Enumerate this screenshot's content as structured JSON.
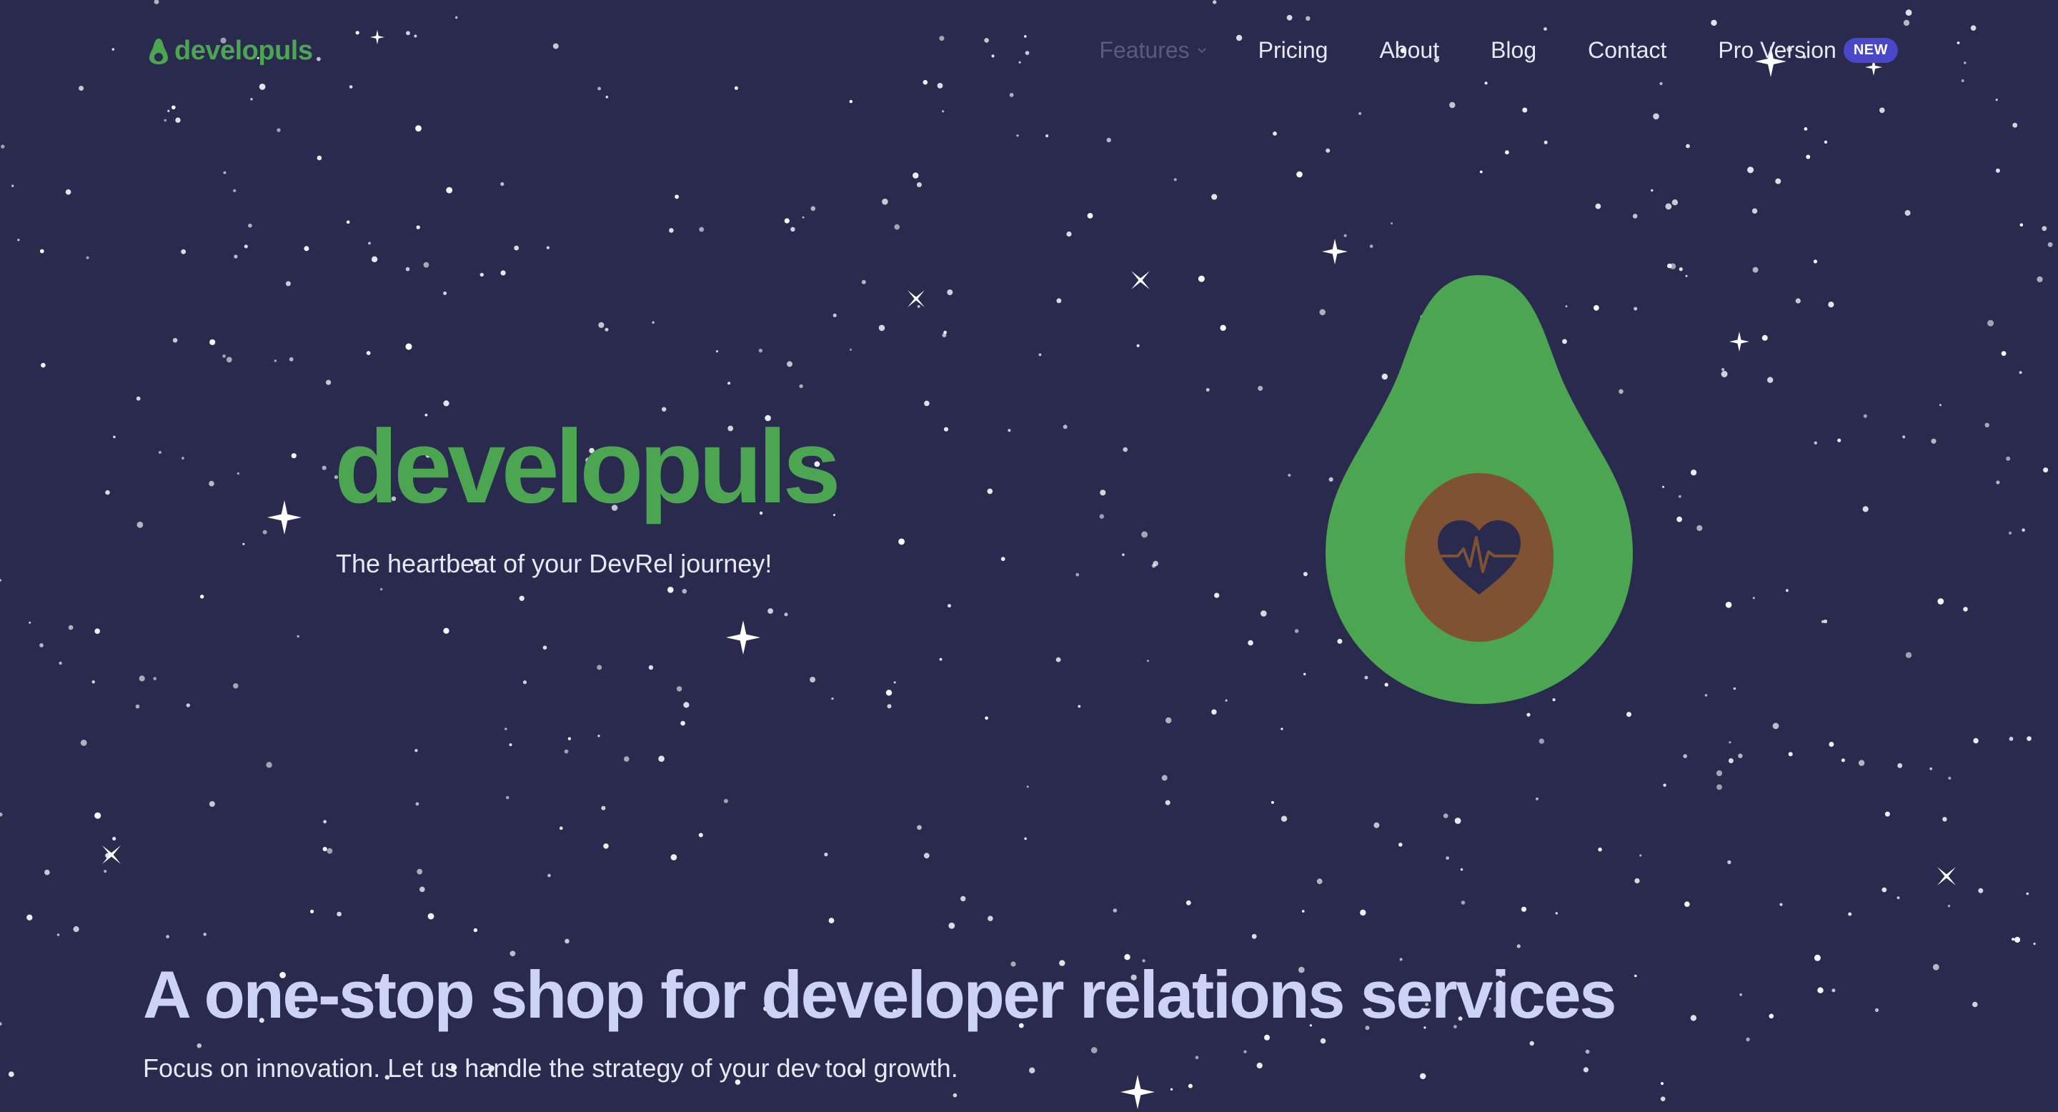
{
  "nav": {
    "logo_text": "developuls",
    "logo_icon": "avocado-icon",
    "items": [
      {
        "label": "Features",
        "has_dropdown": true
      },
      {
        "label": "Pricing"
      },
      {
        "label": "About"
      },
      {
        "label": "Blog"
      },
      {
        "label": "Contact"
      },
      {
        "label": "Pro Version",
        "badge": "NEW"
      }
    ]
  },
  "hero": {
    "title": "developuls",
    "subtitle": "The heartbeat of your DevRel journey!",
    "illustration_icon": "avocado-heartbeat-icon"
  },
  "section": {
    "title": "A one-stop shop for developer relations services",
    "subtitle": "Focus on innovation. Let us handle the strategy of your dev tool growth."
  },
  "colors": {
    "background": "#2a2a4e",
    "brand_green": "#4ba551",
    "pit_brown": "#7e5232",
    "badge_purple": "#4a47c9",
    "heading_lavender": "#cdd3f7",
    "text_light": "#e6e8f5"
  }
}
